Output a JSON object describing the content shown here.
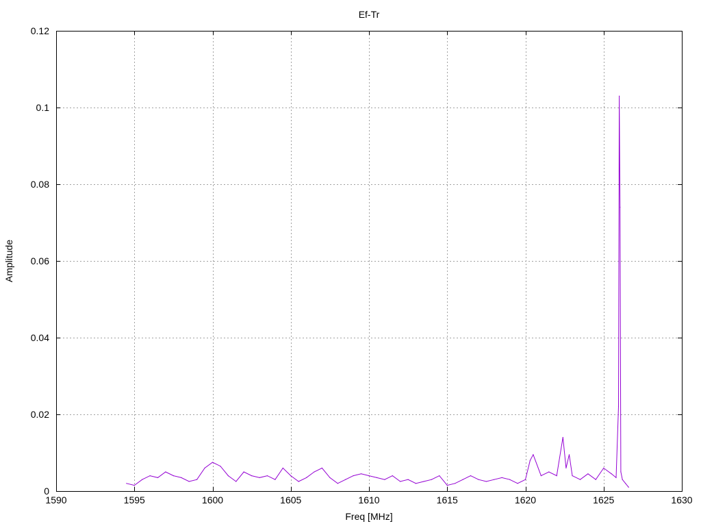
{
  "chart_data": {
    "type": "line",
    "title": "Ef-Tr",
    "xlabel": "Freq [MHz]",
    "ylabel": "Amplitude",
    "xlim": [
      1590,
      1630
    ],
    "ylim": [
      0,
      0.12
    ],
    "grid": true,
    "legend": "none",
    "xticks": [
      "1590",
      "1595",
      "1600",
      "1605",
      "1610",
      "1615",
      "1620",
      "1625",
      "1630"
    ],
    "yticks": [
      "0",
      "0.02",
      "0.04",
      "0.06",
      "0.08",
      "0.1",
      "0.12"
    ],
    "series": [
      {
        "color": "#9400d3",
        "x": [
          1594.5,
          1595.0,
          1595.5,
          1596.0,
          1596.5,
          1597.0,
          1597.5,
          1598.0,
          1598.5,
          1599.0,
          1599.5,
          1600.0,
          1600.5,
          1601.0,
          1601.5,
          1602.0,
          1602.5,
          1603.0,
          1603.5,
          1604.0,
          1604.5,
          1605.0,
          1605.5,
          1606.0,
          1606.5,
          1607.0,
          1607.5,
          1608.0,
          1608.5,
          1609.0,
          1609.5,
          1610.0,
          1610.5,
          1611.0,
          1611.5,
          1612.0,
          1612.5,
          1613.0,
          1613.5,
          1614.0,
          1614.5,
          1615.0,
          1615.5,
          1616.0,
          1616.5,
          1617.0,
          1617.5,
          1618.0,
          1618.5,
          1619.0,
          1619.5,
          1620.0,
          1620.3,
          1620.5,
          1621.0,
          1621.5,
          1622.0,
          1622.4,
          1622.6,
          1622.8,
          1623.0,
          1623.5,
          1624.0,
          1624.5,
          1625.0,
          1625.5,
          1625.8,
          1625.95,
          1626.0,
          1626.05,
          1626.1,
          1626.2,
          1626.4,
          1626.6
        ],
        "y": [
          0.002,
          0.0015,
          0.003,
          0.004,
          0.0035,
          0.005,
          0.004,
          0.0035,
          0.0025,
          0.003,
          0.006,
          0.0075,
          0.0065,
          0.004,
          0.0025,
          0.005,
          0.004,
          0.0035,
          0.004,
          0.003,
          0.006,
          0.004,
          0.0025,
          0.0035,
          0.005,
          0.006,
          0.0035,
          0.002,
          0.003,
          0.004,
          0.0045,
          0.004,
          0.0035,
          0.003,
          0.004,
          0.0025,
          0.003,
          0.002,
          0.0025,
          0.003,
          0.004,
          0.0015,
          0.002,
          0.003,
          0.004,
          0.003,
          0.0025,
          0.003,
          0.0035,
          0.003,
          0.002,
          0.003,
          0.008,
          0.0095,
          0.004,
          0.005,
          0.004,
          0.014,
          0.006,
          0.0095,
          0.004,
          0.003,
          0.0045,
          0.003,
          0.006,
          0.0045,
          0.0035,
          0.022,
          0.103,
          0.074,
          0.005,
          0.003,
          0.002,
          0.001
        ]
      }
    ]
  }
}
